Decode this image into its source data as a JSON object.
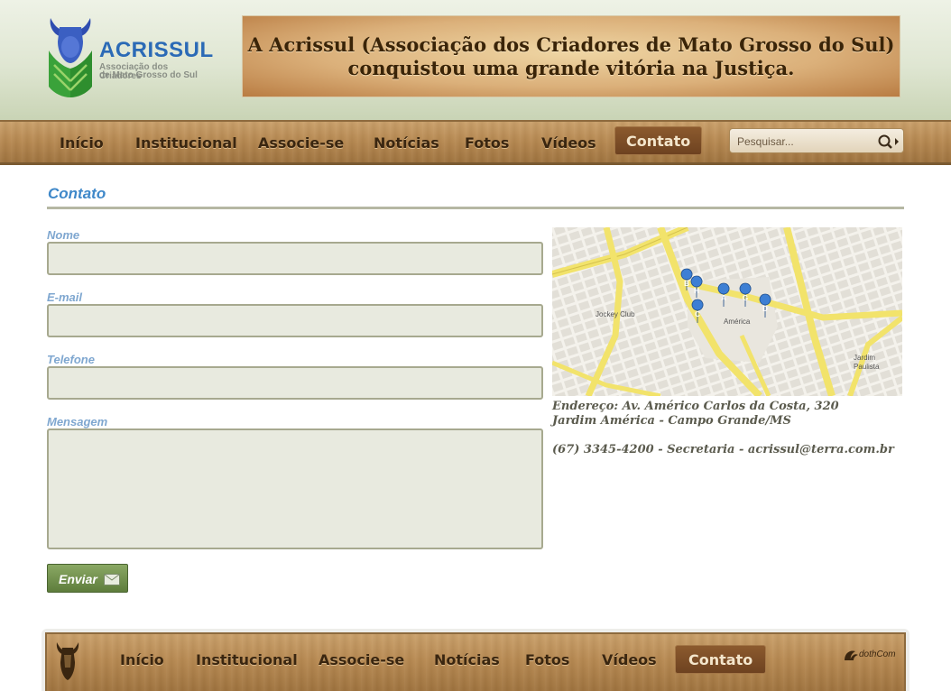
{
  "site": {
    "logo_name": "ACRISSUL",
    "logo_sub1": "Associação dos Criadores",
    "logo_sub2": "de Mato Grosso do Sul"
  },
  "banner": {
    "line1": "A Acrissul (Associação dos Criadores de Mato Grosso do Sul)",
    "line2": "conquistou uma grande vitória na Justiça."
  },
  "nav": {
    "items": [
      {
        "label": "Início"
      },
      {
        "label": "Institucional"
      },
      {
        "label": "Associe-se"
      },
      {
        "label": "Notícias"
      },
      {
        "label": "Fotos"
      },
      {
        "label": "Vídeos"
      },
      {
        "label": "Contato",
        "active": true
      }
    ]
  },
  "search": {
    "placeholder": "Pesquisar..."
  },
  "page": {
    "title": "Contato"
  },
  "form": {
    "name_label": "Nome",
    "email_label": "E-mail",
    "phone_label": "Telefone",
    "message_label": "Mensagem",
    "name_value": "",
    "email_value": "",
    "phone_value": "",
    "message_value": "",
    "submit_label": "Enviar"
  },
  "map": {
    "label_america": "América",
    "label_jockey": "Jockey Club",
    "label_jardim1": "Jardim",
    "label_jardim2": "Paulista",
    "markers": [
      "A",
      "B",
      "C",
      "D",
      "G",
      "H"
    ]
  },
  "contact": {
    "address_line1": "Endereço: Av. Américo Carlos da Costa, 320",
    "address_line2": "Jardim América - Campo Grande/MS",
    "phone_line": "(67) 3345-4200 - Secretaria - acrissul@terra.com.br"
  },
  "footer": {
    "items": [
      {
        "label": "Início"
      },
      {
        "label": "Institucional"
      },
      {
        "label": "Associe-se"
      },
      {
        "label": "Notícias"
      },
      {
        "label": "Fotos"
      },
      {
        "label": "Vídeos"
      },
      {
        "label": "Contato",
        "active": true
      }
    ],
    "credit": "dothCom"
  },
  "colors": {
    "accent_blue": "#3f88c9",
    "label_blue": "#7fa7d0",
    "wood": "#b88a52",
    "button_green": "#6e8c49"
  }
}
